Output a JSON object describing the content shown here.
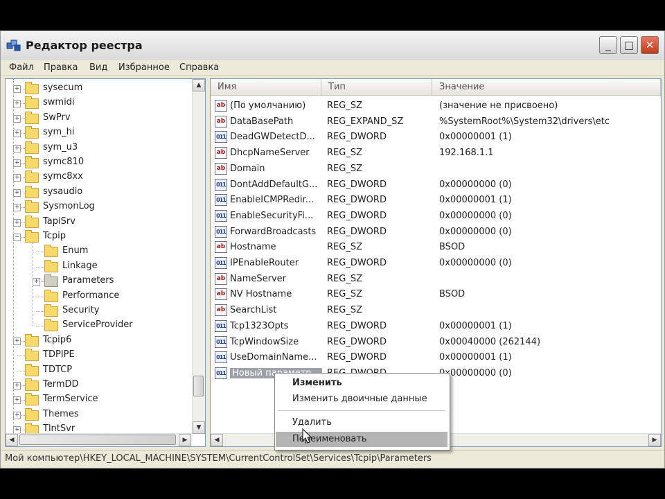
{
  "window": {
    "title": "Редактор реестра",
    "buttons": {
      "minimize": "_",
      "maximize": "□",
      "close": "✕"
    }
  },
  "menu": [
    "Файл",
    "Правка",
    "Вид",
    "Избранное",
    "Справка"
  ],
  "tree": [
    {
      "label": "sysecum",
      "depth": 0,
      "expander": "+"
    },
    {
      "label": "swmidi",
      "depth": 0,
      "expander": "+"
    },
    {
      "label": "SwPrv",
      "depth": 0,
      "expander": "+"
    },
    {
      "label": "sym_hi",
      "depth": 0,
      "expander": "+"
    },
    {
      "label": "sym_u3",
      "depth": 0,
      "expander": "+"
    },
    {
      "label": "symc810",
      "depth": 0,
      "expander": "+"
    },
    {
      "label": "symc8xx",
      "depth": 0,
      "expander": "+"
    },
    {
      "label": "sysaudio",
      "depth": 0,
      "expander": "+"
    },
    {
      "label": "SysmonLog",
      "depth": 0,
      "expander": "+"
    },
    {
      "label": "TapiSrv",
      "depth": 0,
      "expander": "+"
    },
    {
      "label": "Tcpip",
      "depth": 0,
      "expander": "−"
    },
    {
      "label": "Enum",
      "depth": 1,
      "expander": ""
    },
    {
      "label": "Linkage",
      "depth": 1,
      "expander": ""
    },
    {
      "label": "Parameters",
      "depth": 1,
      "expander": "+",
      "open": true
    },
    {
      "label": "Performance",
      "depth": 1,
      "expander": ""
    },
    {
      "label": "Security",
      "depth": 1,
      "expander": ""
    },
    {
      "label": "ServiceProvider",
      "depth": 1,
      "expander": ""
    },
    {
      "label": "Tcpip6",
      "depth": 0,
      "expander": "+"
    },
    {
      "label": "TDPIPE",
      "depth": 0,
      "expander": ""
    },
    {
      "label": "TDTCP",
      "depth": 0,
      "expander": ""
    },
    {
      "label": "TermDD",
      "depth": 0,
      "expander": "+"
    },
    {
      "label": "TermService",
      "depth": 0,
      "expander": "+"
    },
    {
      "label": "Themes",
      "depth": 0,
      "expander": "+"
    },
    {
      "label": "TlntSvr",
      "depth": 0,
      "expander": "+"
    }
  ],
  "columns": [
    "Имя",
    "Тип",
    "Значение"
  ],
  "values": [
    {
      "icon": "ab",
      "name": "(По умолчанию)",
      "type": "REG_SZ",
      "data": "(значение не присвоено)"
    },
    {
      "icon": "ab",
      "name": "DataBasePath",
      "type": "REG_EXPAND_SZ",
      "data": "%SystemRoot%\\System32\\drivers\\etc"
    },
    {
      "icon": "dw",
      "name": "DeadGWDetectD...",
      "type": "REG_DWORD",
      "data": "0x00000001 (1)"
    },
    {
      "icon": "ab",
      "name": "DhcpNameServer",
      "type": "REG_SZ",
      "data": "192.168.1.1"
    },
    {
      "icon": "ab",
      "name": "Domain",
      "type": "REG_SZ",
      "data": ""
    },
    {
      "icon": "dw",
      "name": "DontAddDefaultG...",
      "type": "REG_DWORD",
      "data": "0x00000000 (0)"
    },
    {
      "icon": "dw",
      "name": "EnableICMPRedir...",
      "type": "REG_DWORD",
      "data": "0x00000001 (1)"
    },
    {
      "icon": "dw",
      "name": "EnableSecurityFi...",
      "type": "REG_DWORD",
      "data": "0x00000000 (0)"
    },
    {
      "icon": "dw",
      "name": "ForwardBroadcasts",
      "type": "REG_DWORD",
      "data": "0x00000000 (0)"
    },
    {
      "icon": "ab",
      "name": "Hostname",
      "type": "REG_SZ",
      "data": "BSOD"
    },
    {
      "icon": "dw",
      "name": "IPEnableRouter",
      "type": "REG_DWORD",
      "data": "0x00000000 (0)"
    },
    {
      "icon": "ab",
      "name": "NameServer",
      "type": "REG_SZ",
      "data": ""
    },
    {
      "icon": "ab",
      "name": "NV Hostname",
      "type": "REG_SZ",
      "data": "BSOD"
    },
    {
      "icon": "ab",
      "name": "SearchList",
      "type": "REG_SZ",
      "data": ""
    },
    {
      "icon": "dw",
      "name": "Tcp1323Opts",
      "type": "REG_DWORD",
      "data": "0x00000001 (1)"
    },
    {
      "icon": "dw",
      "name": "TcpWindowSize",
      "type": "REG_DWORD",
      "data": "0x00040000 (262144)"
    },
    {
      "icon": "dw",
      "name": "UseDomainName...",
      "type": "REG_DWORD",
      "data": "0x00000001 (1)"
    },
    {
      "icon": "dw",
      "name": "Новый параметр...",
      "type": "REG_DWORD",
      "data": "0x00000000 (0)",
      "selected": true
    }
  ],
  "context_menu": {
    "modify": "Изменить",
    "modify_binary": "Изменить двоичные данные",
    "delete": "Удалить",
    "rename": "Переименовать"
  },
  "status_path": "Мой компьютер\\HKEY_LOCAL_MACHINE\\SYSTEM\\CurrentControlSet\\Services\\Tcpip\\Parameters"
}
